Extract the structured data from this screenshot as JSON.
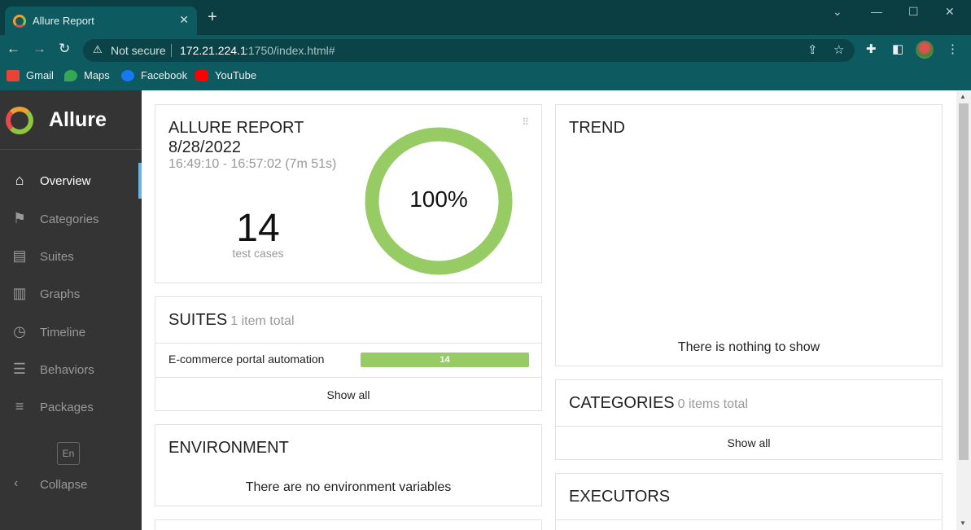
{
  "browser": {
    "tab_title": "Allure Report",
    "url_security": "Not secure",
    "url_host": "172.21.224.1",
    "url_path": ":1750/index.html#",
    "bookmarks": [
      {
        "label": "Gmail",
        "icon": "gmail-icon",
        "color": "#ea4335"
      },
      {
        "label": "Maps",
        "icon": "maps-icon",
        "color": "#34a853"
      },
      {
        "label": "Facebook",
        "icon": "facebook-icon",
        "color": "#1877f2"
      },
      {
        "label": "YouTube",
        "icon": "youtube-icon",
        "color": "#ff0000"
      }
    ]
  },
  "sidebar": {
    "brand": "Allure",
    "items": [
      {
        "label": "Overview",
        "icon": "home-icon",
        "active": true
      },
      {
        "label": "Categories",
        "icon": "flag-icon"
      },
      {
        "label": "Suites",
        "icon": "briefcase-icon"
      },
      {
        "label": "Graphs",
        "icon": "bar-chart-icon"
      },
      {
        "label": "Timeline",
        "icon": "clock-icon"
      },
      {
        "label": "Behaviors",
        "icon": "list-icon"
      },
      {
        "label": "Packages",
        "icon": "align-left-icon"
      }
    ],
    "language": "En",
    "collapse_label": "Collapse"
  },
  "summary": {
    "title_line1": "ALLURE REPORT",
    "title_line2": "8/28/2022",
    "time_range": "16:49:10 - 16:57:02 (7m 51s)",
    "test_count": "14",
    "test_count_label": "test cases",
    "pass_percent_label": "100%",
    "pass_fraction": 1.0,
    "pass_color": "#97cc64"
  },
  "suites": {
    "title": "SUITES",
    "subtitle": "1 item total",
    "rows": [
      {
        "name": "E-commerce portal automation",
        "passed": "14"
      }
    ],
    "show_all": "Show all"
  },
  "environment": {
    "title": "ENVIRONMENT",
    "empty_text": "There are no environment variables"
  },
  "trend": {
    "title": "TREND",
    "empty_text": "There is nothing to show"
  },
  "categories": {
    "title": "CATEGORIES",
    "subtitle": "0 items total",
    "show_all": "Show all"
  },
  "executors": {
    "title": "EXECUTORS"
  }
}
